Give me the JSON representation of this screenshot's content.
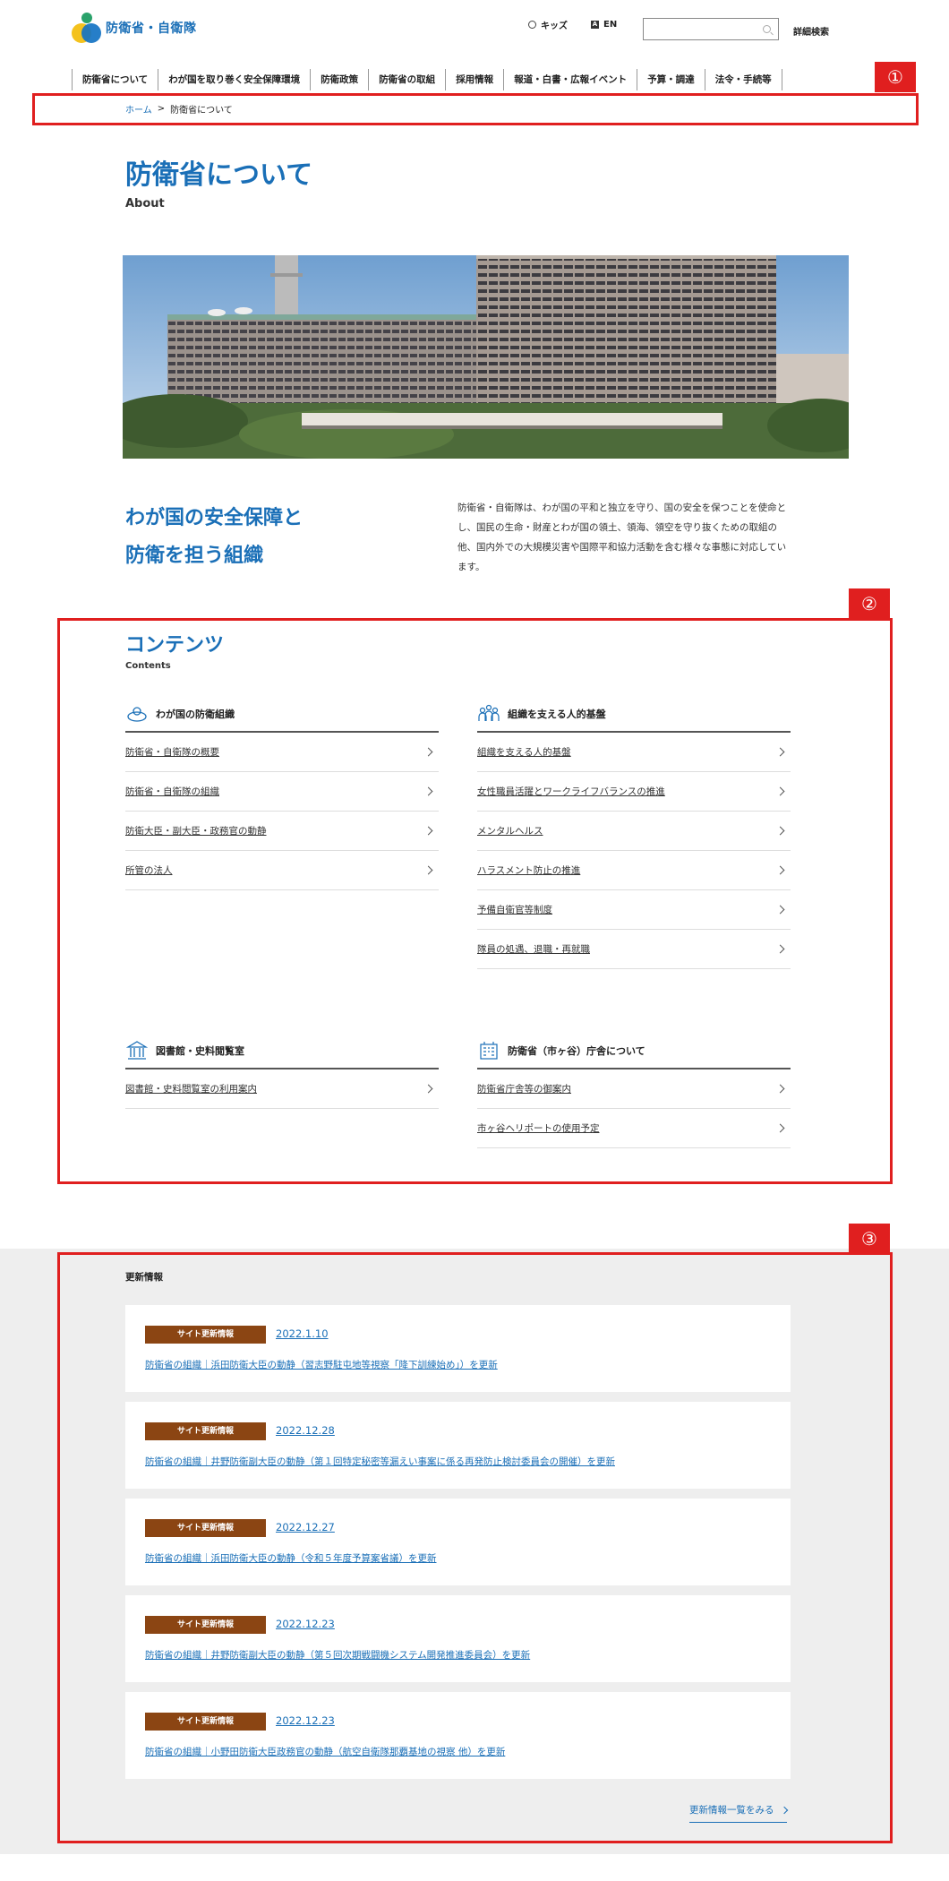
{
  "header": {
    "logo_text": "防衛省・自衛隊",
    "kids_label": "キッズ",
    "en_label": "EN",
    "en_glyph": "A",
    "search_placeholder": "",
    "advanced_search": "詳細検索"
  },
  "nav": [
    "防衛省について",
    "わが国を取り巻く安全保障環境",
    "防衛政策",
    "防衛省の取組",
    "採用情報",
    "報道・白書・広報イベント",
    "予算・調達",
    "法令・手続等"
  ],
  "breadcrumb": {
    "home": "ホーム",
    "separator": ">",
    "current": "防衛省について"
  },
  "markers": [
    "①",
    "②",
    "③"
  ],
  "page": {
    "title": "防衛省について",
    "subtitle": "About"
  },
  "intro": {
    "heading_line1": "わが国の安全保障と",
    "heading_line2": "防衛を担う組織",
    "body": "防衛省・自衛隊は、わが国の平和と独立を守り、国の安全を保つことを使命とし、国民の生命・財産とわが国の領土、領海、領空を守り抜くための取組の他、国内外での大規模災害や国際平和協力活動を含む様々な事態に対応しています。"
  },
  "contents": {
    "title": "コンテンツ",
    "subtitle": "Contents",
    "groups": [
      {
        "icon": "defense-organization-icon",
        "title": "わが国の防衛組織",
        "links": [
          "防衛省・自衛隊の概要",
          "防衛省・自衛隊の組織",
          "防衛大臣・副大臣・政務官の動静",
          "所管の法人"
        ]
      },
      {
        "icon": "people-icon",
        "title": "組織を支える人的基盤",
        "links": [
          "組織を支える人的基盤",
          "女性職員活躍とワークライフバランスの推進",
          "メンタルヘルス",
          "ハラスメント防止の推進",
          "予備自衛官等制度",
          "隊員の処遇、退職・再就職"
        ]
      },
      {
        "icon": "library-icon",
        "title": "図書館・史料閲覧室",
        "links": [
          "図書館・史料閲覧室の利用案内"
        ]
      },
      {
        "icon": "building-icon",
        "title": "防衛省（市ヶ谷）庁舎について",
        "links": [
          "防衛省庁舎等の御案内",
          "市ヶ谷ヘリポートの使用予定"
        ]
      }
    ]
  },
  "updates": {
    "title": "更新情報",
    "items": [
      {
        "badge": "サイト更新情報",
        "date": "2022.1.10",
        "text": "防衛省の組織｜浜田防衛大臣の動静（習志野駐屯地等視察「降下訓練始め」）を更新"
      },
      {
        "badge": "サイト更新情報",
        "date": "2022.12.28",
        "text": "防衛省の組織｜井野防衛副大臣の動静（第１回特定秘密等漏えい事案に係る再発防止検討委員会の開催）を更新"
      },
      {
        "badge": "サイト更新情報",
        "date": "2022.12.27",
        "text": "防衛省の組織｜浜田防衛大臣の動静（令和５年度予算案省議）を更新"
      },
      {
        "badge": "サイト更新情報",
        "date": "2022.12.23",
        "text": "防衛省の組織｜井野防衛副大臣の動静（第５回次期戦闘機システム開発推進委員会）を更新"
      },
      {
        "badge": "サイト更新情報",
        "date": "2022.12.23",
        "text": "防衛省の組織｜小野田防衛大臣政務官の動静（航空自衛隊那覇基地の視察 他）を更新"
      }
    ],
    "more_label": "更新情報一覧をみる"
  }
}
